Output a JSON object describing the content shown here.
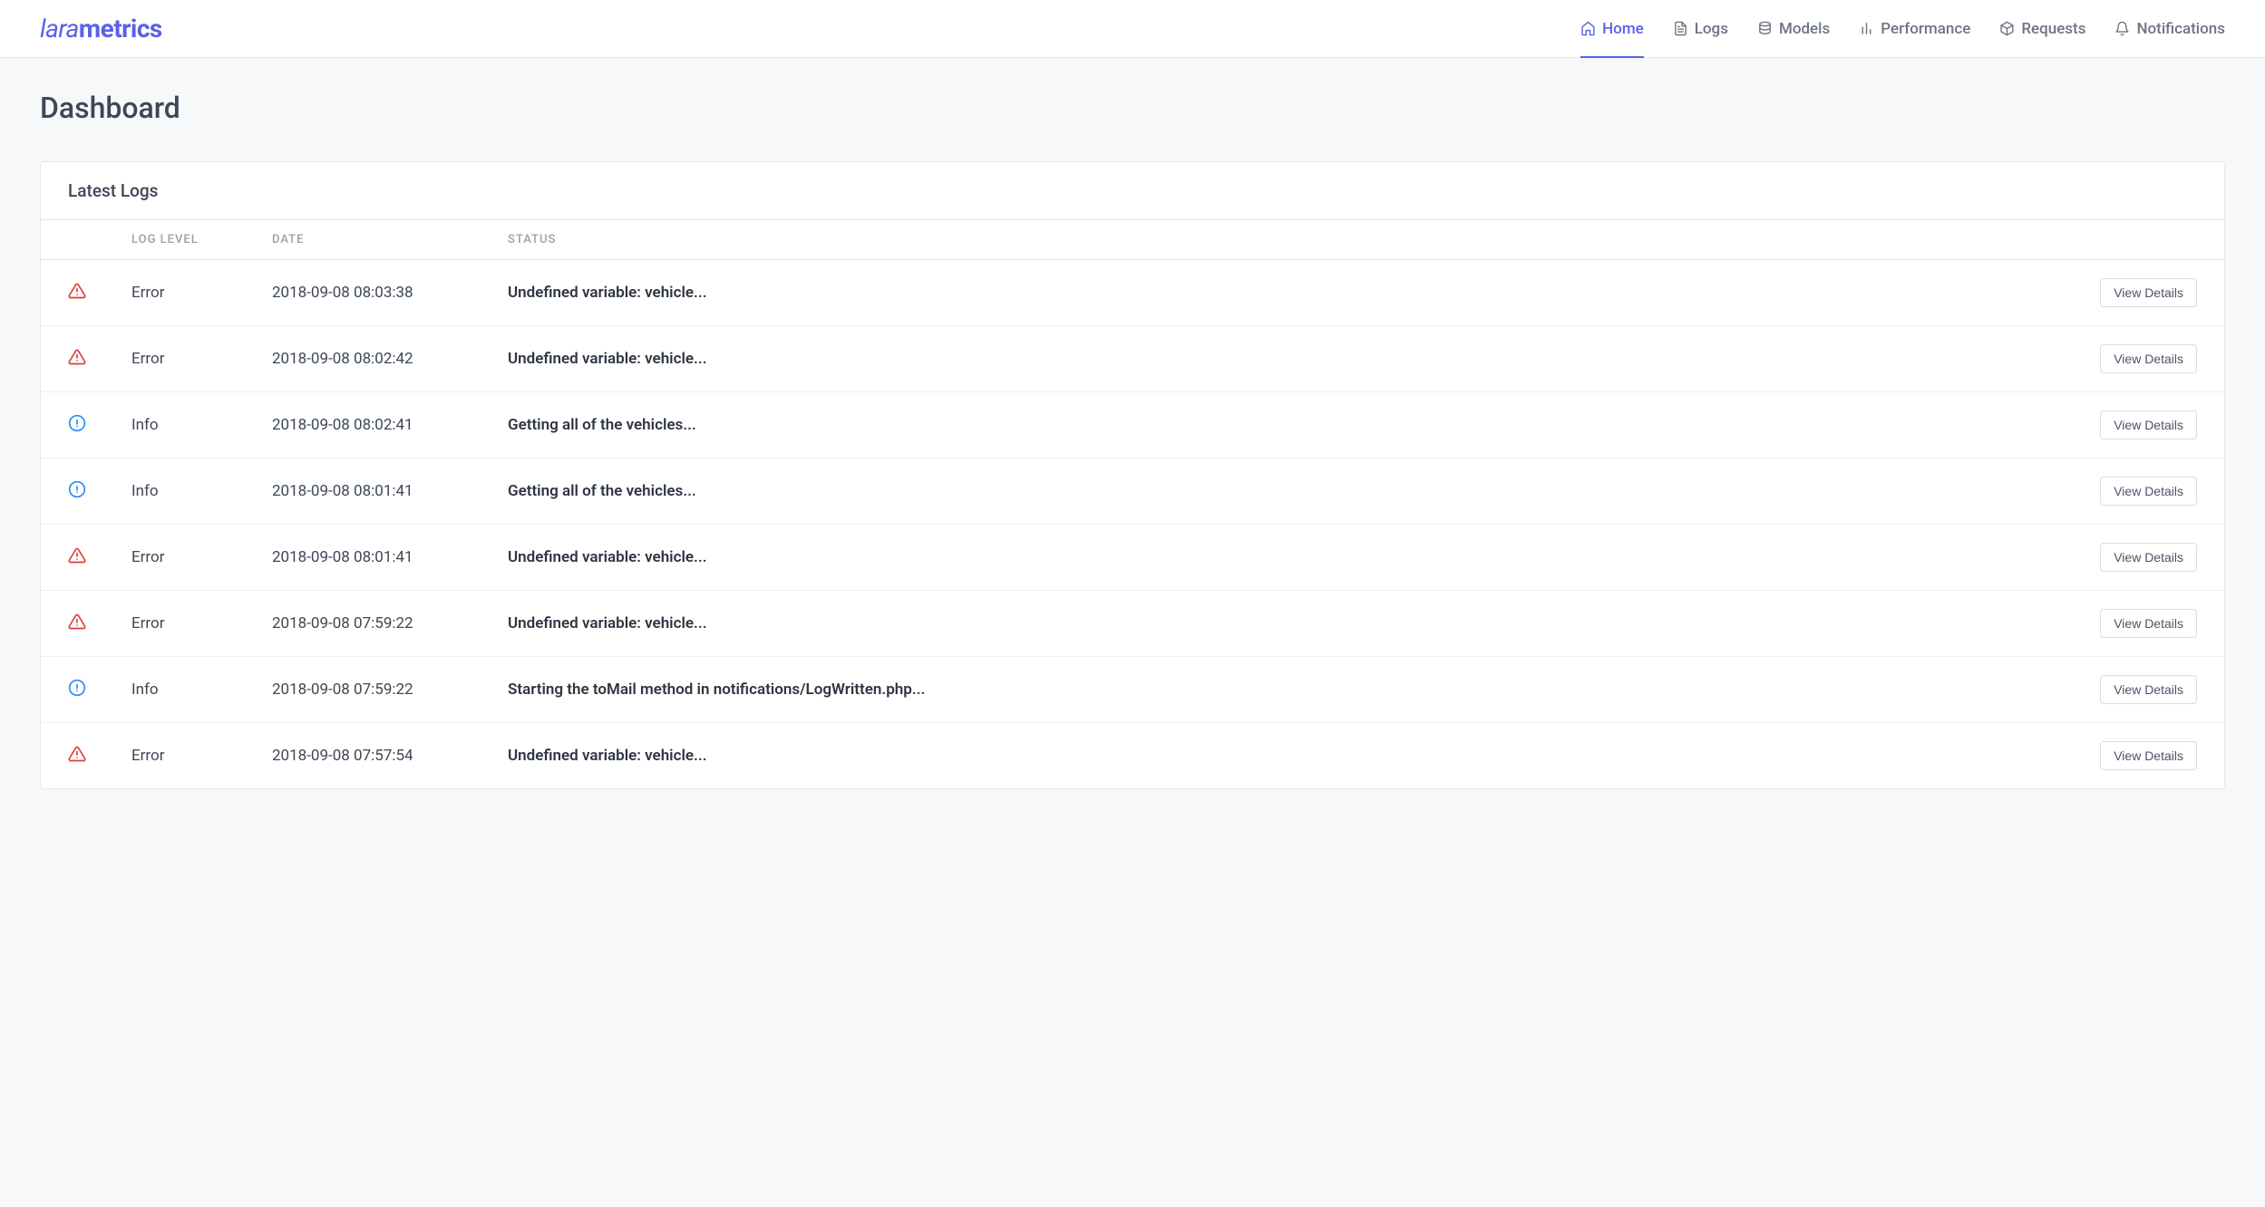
{
  "brand": {
    "light": "lara",
    "bold": "metrics"
  },
  "nav": [
    {
      "label": "Home",
      "icon": "home",
      "active": true
    },
    {
      "label": "Logs",
      "icon": "file-text",
      "active": false
    },
    {
      "label": "Models",
      "icon": "database",
      "active": false
    },
    {
      "label": "Performance",
      "icon": "bar-chart",
      "active": false
    },
    {
      "label": "Requests",
      "icon": "package",
      "active": false
    },
    {
      "label": "Notifications",
      "icon": "bell",
      "active": false
    }
  ],
  "page": {
    "title": "Dashboard"
  },
  "card": {
    "title": "Latest Logs"
  },
  "table": {
    "headers": {
      "level": "LOG LEVEL",
      "date": "DATE",
      "status": "STATUS"
    },
    "action_label": "View Details",
    "rows": [
      {
        "level": "Error",
        "date": "2018-09-08 08:03:38",
        "status": "Undefined variable: vehicle..."
      },
      {
        "level": "Error",
        "date": "2018-09-08 08:02:42",
        "status": "Undefined variable: vehicle..."
      },
      {
        "level": "Info",
        "date": "2018-09-08 08:02:41",
        "status": "Getting all of the vehicles..."
      },
      {
        "level": "Info",
        "date": "2018-09-08 08:01:41",
        "status": "Getting all of the vehicles..."
      },
      {
        "level": "Error",
        "date": "2018-09-08 08:01:41",
        "status": "Undefined variable: vehicle..."
      },
      {
        "level": "Error",
        "date": "2018-09-08 07:59:22",
        "status": "Undefined variable: vehicle..."
      },
      {
        "level": "Info",
        "date": "2018-09-08 07:59:22",
        "status": "Starting the toMail method in notifications/LogWritten.php..."
      },
      {
        "level": "Error",
        "date": "2018-09-08 07:57:54",
        "status": "Undefined variable: vehicle..."
      }
    ]
  }
}
